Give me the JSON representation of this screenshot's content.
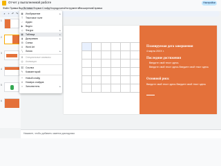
{
  "titlebar": {
    "doc_title": "Отчет у выполненной работе"
  },
  "menubar": {
    "items": [
      "Файл",
      "Правка",
      "Вид",
      "Вставка",
      "Формат",
      "Слайд",
      "Упорядочить",
      "Инструменты",
      "Расширения",
      "Справка"
    ]
  },
  "share_label": "Настройки",
  "filmstrip": {
    "numbers": [
      "1",
      "2",
      "3",
      "4",
      "5",
      "6"
    ]
  },
  "dropdown": {
    "items": [
      {
        "icon": "image-icon",
        "glyph": "▣",
        "label": "Изображение",
        "arrow": "▸"
      },
      {
        "icon": "textbox-icon",
        "glyph": "T",
        "label": "Текстовое поле",
        "arrow": ""
      },
      {
        "icon": "audio-icon",
        "glyph": "♪",
        "label": "Аудио",
        "arrow": ""
      },
      {
        "icon": "video-icon",
        "glyph": "▶",
        "label": "Видео",
        "arrow": ""
      },
      {
        "icon": "shape-icon",
        "glyph": "◇",
        "label": "Фигура",
        "arrow": "▸"
      },
      {
        "icon": "table-icon",
        "glyph": "▦",
        "label": "Таблица",
        "arrow": "▸"
      },
      {
        "icon": "chart-icon",
        "glyph": "▮",
        "label": "Диаграмма",
        "arrow": "▸"
      },
      {
        "icon": "diagram-icon",
        "glyph": "⊞",
        "label": "Схема",
        "arrow": ""
      },
      {
        "icon": "wordart-icon",
        "glyph": "A",
        "label": "Word Art",
        "arrow": ""
      },
      {
        "icon": "line-icon",
        "glyph": "╲",
        "label": "Линия",
        "arrow": "▸"
      },
      {
        "icon": "special-chars-icon",
        "glyph": "Ω",
        "label": "Специальные символы",
        "arrow": ""
      },
      {
        "icon": "animation-icon",
        "glyph": "◎",
        "label": "Анимация",
        "arrow": ""
      },
      {
        "icon": "link-icon",
        "glyph": "⛓",
        "label": "Ссылка",
        "arrow": ""
      },
      {
        "icon": "comment-icon",
        "glyph": "✎",
        "label": "Комментарий",
        "arrow": ""
      },
      {
        "icon": "new-slide-icon",
        "glyph": "+",
        "label": "Новый слайд",
        "arrow": ""
      },
      {
        "icon": "slide-numbers-icon",
        "glyph": "#",
        "label": "Номера слайдов",
        "arrow": ""
      },
      {
        "icon": "placeholder-icon",
        "glyph": "□",
        "label": "Заполнитель",
        "arrow": "▸"
      }
    ]
  },
  "slide": {
    "heading1": "Планируемая дата завершения",
    "text1": "4 марта 20XX г.",
    "heading2": "Последние достижения",
    "bullet1": "Введите свой текст здесь",
    "bullet2": "Введите свой текст здесь Введите свой текст здесь",
    "heading3": "Основной риск",
    "text3": "Введите свой текст здесь Введите свой текст здесь"
  },
  "notes": {
    "placeholder": "Нажмите, чтобы добавить заметки докладчика"
  },
  "colors": {
    "accent": "#e4713a",
    "selected_thumb": "#f9ab00"
  }
}
